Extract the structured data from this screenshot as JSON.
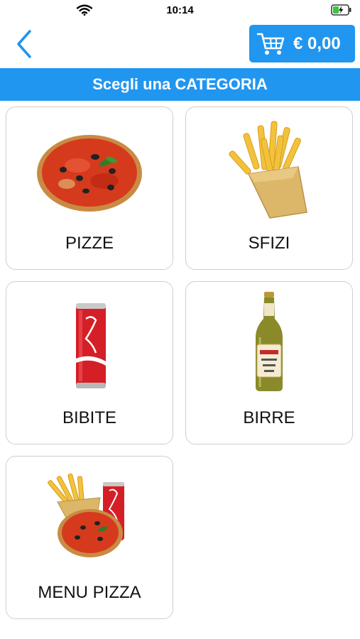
{
  "status_bar": {
    "time": "10:14"
  },
  "header": {
    "cart_total": "€ 0,00"
  },
  "category_bar": {
    "title": "Scegli una CATEGORIA"
  },
  "categories": [
    {
      "label": "PIZZE",
      "icon": "pizza"
    },
    {
      "label": "SFIZI",
      "icon": "french-fries"
    },
    {
      "label": "BIBITE",
      "icon": "cola-can"
    },
    {
      "label": "BIRRE",
      "icon": "beer-bottle"
    },
    {
      "label": "MENU PIZZA",
      "icon": "pizza-combo"
    }
  ],
  "colors": {
    "accent": "#2196f0",
    "tile_border": "#cfcfcf"
  }
}
